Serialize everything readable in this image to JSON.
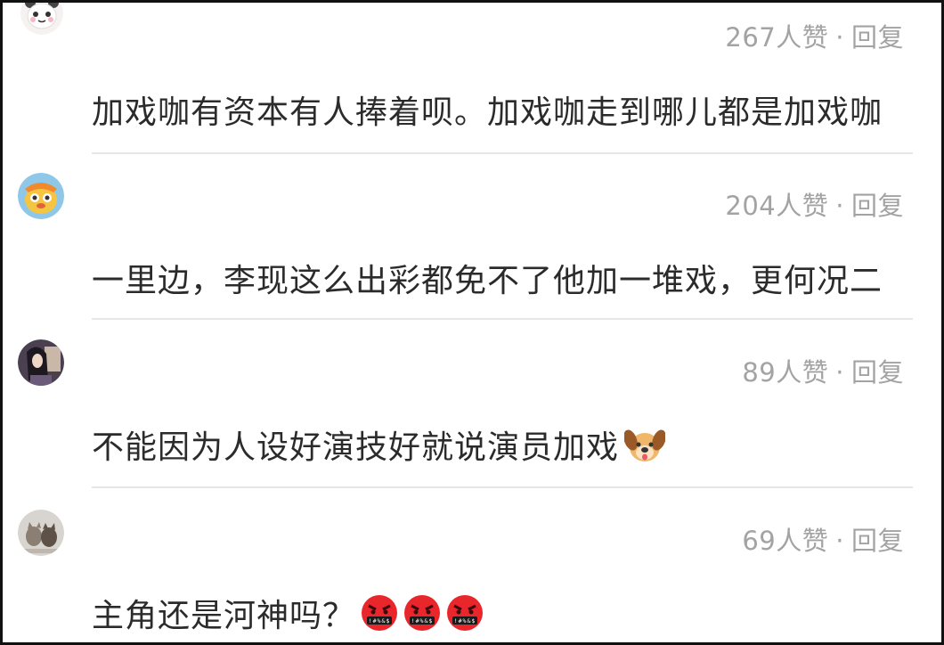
{
  "comments": [
    {
      "likes": "267人赞",
      "separator": "·",
      "reply": "回复",
      "text": "加戏咖有资本有人捧着呗。加戏咖走到哪儿都是加戏咖",
      "avatar_icon": "panda-avatar-icon"
    },
    {
      "likes": "204人赞",
      "separator": "·",
      "reply": "回复",
      "text": "一里边，李现这么出彩都免不了他加一堆戏，更何况二",
      "avatar_icon": "cartoon-avatar-icon"
    },
    {
      "likes": "89人赞",
      "separator": "·",
      "reply": "回复",
      "text": "不能因为人设好演技好就说演员加戏",
      "avatar_icon": "photo-avatar-icon",
      "emojis": [
        "dog-face-emoji"
      ]
    },
    {
      "likes": "69人赞",
      "separator": "·",
      "reply": "回复",
      "text": "主角还是河神吗？",
      "avatar_icon": "cats-photo-avatar-icon",
      "emojis": [
        "cursing-face-emoji",
        "cursing-face-emoji",
        "cursing-face-emoji"
      ]
    }
  ],
  "colors": {
    "meta_gray": "#a3a3a3",
    "text_dark": "#2b2b2b",
    "divider": "#e6e6e6"
  }
}
